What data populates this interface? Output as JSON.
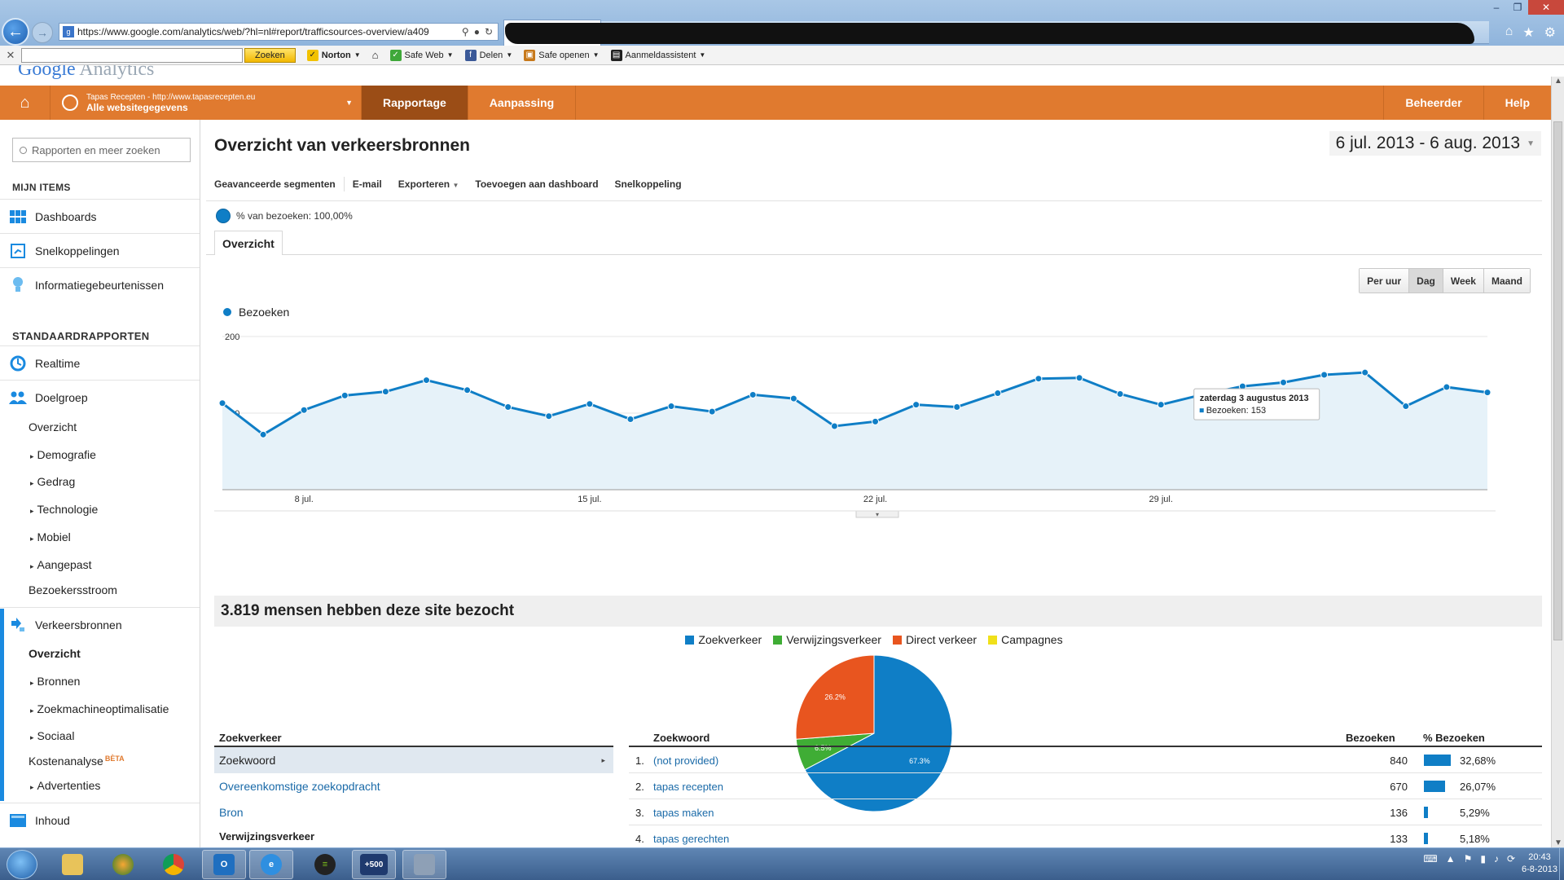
{
  "browser": {
    "url": "https://www.google.com/analytics/web/?hl=nl#report/trafficsources-overview/a409",
    "toolbar": {
      "search_button": "Zoeken",
      "norton": "Norton",
      "safe_web": "Safe Web",
      "delen": "Delen",
      "safe_openen": "Safe openen",
      "aanmeldassistent": "Aanmeldassistent"
    }
  },
  "ga_header": {
    "site_line1": "Tapas Recepten - http://www.tapasrecepten.eu",
    "site_line2": "Alle websitegegevens",
    "tabs": [
      "Rapportage",
      "Aanpassing"
    ],
    "right": [
      "Beheerder",
      "Help"
    ]
  },
  "sidebar": {
    "search_placeholder": "Rapporten en meer zoeken",
    "my_items_title": "MIJN ITEMS",
    "my_items": [
      "Dashboards",
      "Snelkoppelingen",
      "Informatiegebeurtenissen"
    ],
    "standard_title": "STANDAARDRAPPORTEN",
    "realtime": "Realtime",
    "audience": "Doelgroep",
    "audience_sub": [
      "Overzicht",
      "Demografie",
      "Gedrag",
      "Technologie",
      "Mobiel",
      "Aangepast"
    ],
    "visitor_flow": "Bezoekersstroom",
    "traffic": "Verkeersbronnen",
    "traffic_sub": [
      "Overzicht",
      "Bronnen",
      "Zoekmachineoptimalisatie",
      "Sociaal"
    ],
    "cost_analysis": "Kostenanalyse",
    "beta": "BÈTA",
    "ads": "Advertenties",
    "content": "Inhoud"
  },
  "main": {
    "title": "Overzicht van verkeersbronnen",
    "date_range": "6 jul. 2013 - 6 aug. 2013",
    "actions": [
      "Geavanceerde segmenten",
      "E-mail",
      "Exporteren",
      "Toevoegen aan dashboard",
      "Snelkoppeling"
    ],
    "segment_label": "% van bezoeken: 100,00%",
    "tab": "Overzicht",
    "granularity": [
      "Per uur",
      "Dag",
      "Week",
      "Maand"
    ],
    "granularity_selected": "Dag",
    "summary": "3.819 mensen hebben deze site bezocht",
    "tooltip_title": "zaterdag 3 augustus 2013",
    "tooltip_value": "Bezoeken: 153"
  },
  "chart_data": [
    {
      "type": "line",
      "series": [
        {
          "name": "Bezoeken",
          "values": [
            113,
            72,
            104,
            123,
            128,
            143,
            130,
            108,
            96,
            112,
            92,
            109,
            102,
            124,
            119,
            83,
            89,
            111,
            108,
            126,
            145,
            146,
            125,
            111,
            124,
            135,
            140,
            150,
            153,
            109,
            134,
            127
          ]
        }
      ],
      "x": [
        "6 jul.",
        "7 jul.",
        "8 jul.",
        "9 jul.",
        "10 jul.",
        "11 jul.",
        "12 jul.",
        "13 jul.",
        "14 jul.",
        "15 jul.",
        "16 jul.",
        "17 jul.",
        "18 jul.",
        "19 jul.",
        "20 jul.",
        "21 jul.",
        "22 jul.",
        "23 jul.",
        "24 jul.",
        "25 jul.",
        "26 jul.",
        "27 jul.",
        "28 jul.",
        "29 jul.",
        "30 jul.",
        "31 jul.",
        "1 aug.",
        "2 aug.",
        "3 aug.",
        "4 aug.",
        "5 aug.",
        "6 aug."
      ],
      "x_ticks": [
        "8 jul.",
        "15 jul.",
        "22 jul.",
        "29 jul."
      ],
      "y_ticks": [
        "200",
        "100"
      ],
      "ylim": [
        0,
        200
      ],
      "grid": true,
      "fill_color": "#e6f2f9",
      "line_color": "#0f7ec6"
    },
    {
      "type": "pie",
      "categories": [
        "Zoekverkeer",
        "Verwijzingsverkeer",
        "Direct verkeer",
        "Campagnes"
      ],
      "values": [
        67.3,
        6.5,
        26.2,
        0
      ],
      "labels": [
        "67.3%",
        "6.5%",
        "26.2%",
        ""
      ],
      "colors": [
        "#0f7ec6",
        "#3fad35",
        "#e8551f",
        "#f0e01a"
      ],
      "legend": "top"
    }
  ],
  "search_table": {
    "left_header": "Zoekverkeer",
    "left_rows": [
      "Zoekwoord",
      "Overeenkomstige zoekopdracht",
      "Bron"
    ],
    "left_subheader": "Verwijzingsverkeer",
    "headers": [
      "Zoekwoord",
      "Bezoeken",
      "% Bezoeken"
    ],
    "rows": [
      {
        "idx": "1.",
        "keyword": "(not provided)",
        "visits": "840",
        "pct": "32,68%",
        "frac": 0.3268
      },
      {
        "idx": "2.",
        "keyword": "tapas recepten",
        "visits": "670",
        "pct": "26,07%",
        "frac": 0.2607
      },
      {
        "idx": "3.",
        "keyword": "tapas maken",
        "visits": "136",
        "pct": "5,29%",
        "frac": 0.0529
      },
      {
        "idx": "4.",
        "keyword": "tapas gerechten",
        "visits": "133",
        "pct": "5,18%",
        "frac": 0.0518
      }
    ]
  },
  "taskbar": {
    "clock_time": "20:43",
    "clock_date": "6-8-2013",
    "badge": "+500"
  }
}
